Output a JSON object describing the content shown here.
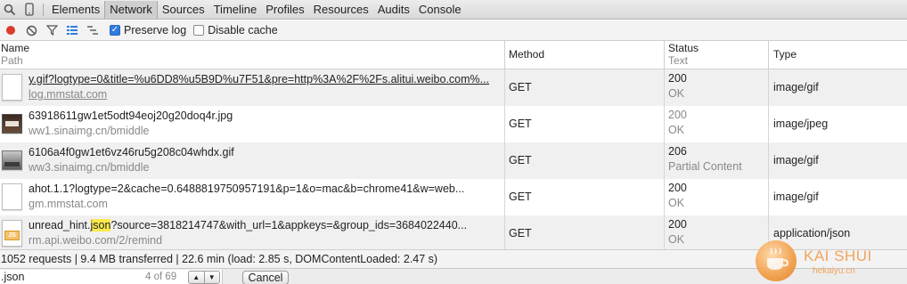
{
  "tabs": [
    "Elements",
    "Network",
    "Sources",
    "Timeline",
    "Profiles",
    "Resources",
    "Audits",
    "Console"
  ],
  "active_tab": "Network",
  "toolbar": {
    "preserve_log_label": "Preserve log",
    "preserve_log_checked": true,
    "disable_cache_label": "Disable cache",
    "disable_cache_checked": false
  },
  "columns": {
    "name": "Name",
    "name_sub": "Path",
    "method": "Method",
    "status": "Status",
    "status_sub": "Text",
    "type": "Type"
  },
  "rows": [
    {
      "name": "y.gif?logtype=0&title=%u6DD8%u5B9D%u7F51&pre=http%3A%2F%2Fs.alitui.weibo.com%...",
      "domain": "log.mmstat.com",
      "method": "GET",
      "status": "200",
      "status_text": "OK",
      "type": "image/gif",
      "icon": "blank-file-icon"
    },
    {
      "name": "63918611gw1et5odt94eoj20g20doq4r.jpg",
      "domain": "ww1.sinaimg.cn/bmiddle",
      "method": "GET",
      "status": "200",
      "status_text": "OK",
      "type": "image/jpeg",
      "icon": "image-thumbnail-icon"
    },
    {
      "name": "6106a4f0gw1et6vz46ru5g208c04whdx.gif",
      "domain": "ww3.sinaimg.cn/bmiddle",
      "method": "GET",
      "status": "206",
      "status_text": "Partial Content",
      "type": "image/gif",
      "icon": "image-thumbnail-icon"
    },
    {
      "name": "ahot.1.1?logtype=2&cache=0.6488819750957191&p=1&o=mac&b=chrome41&w=web...",
      "domain": "gm.mmstat.com",
      "method": "GET",
      "status": "200",
      "status_text": "OK",
      "type": "image/gif",
      "icon": "blank-file-icon"
    },
    {
      "name_pre": "unread_hint.",
      "name_hl": "json",
      "name_post": "?source=3818214747&with_url=1&appkeys=&group_ids=3684022440...",
      "domain": "rm.api.weibo.com/2/remind",
      "method": "GET",
      "status": "200",
      "status_text": "OK",
      "type": "application/json",
      "icon": "js-file-icon"
    }
  ],
  "summary": "1052 requests | 9.4 MB transferred | 22.6 min (load: 2.85 s, DOMContentLoaded: 2.47 s)",
  "find": {
    "query": ".json",
    "count": "4 of 69",
    "cancel_label": "Cancel"
  },
  "watermark": {
    "title": "KAI SHUI",
    "subtitle": "hekaiyu.cn"
  },
  "colors": {
    "record_red": "#d93b2b",
    "checkbox_blue": "#2f7de1",
    "highlight_yellow": "#fbe94a"
  }
}
